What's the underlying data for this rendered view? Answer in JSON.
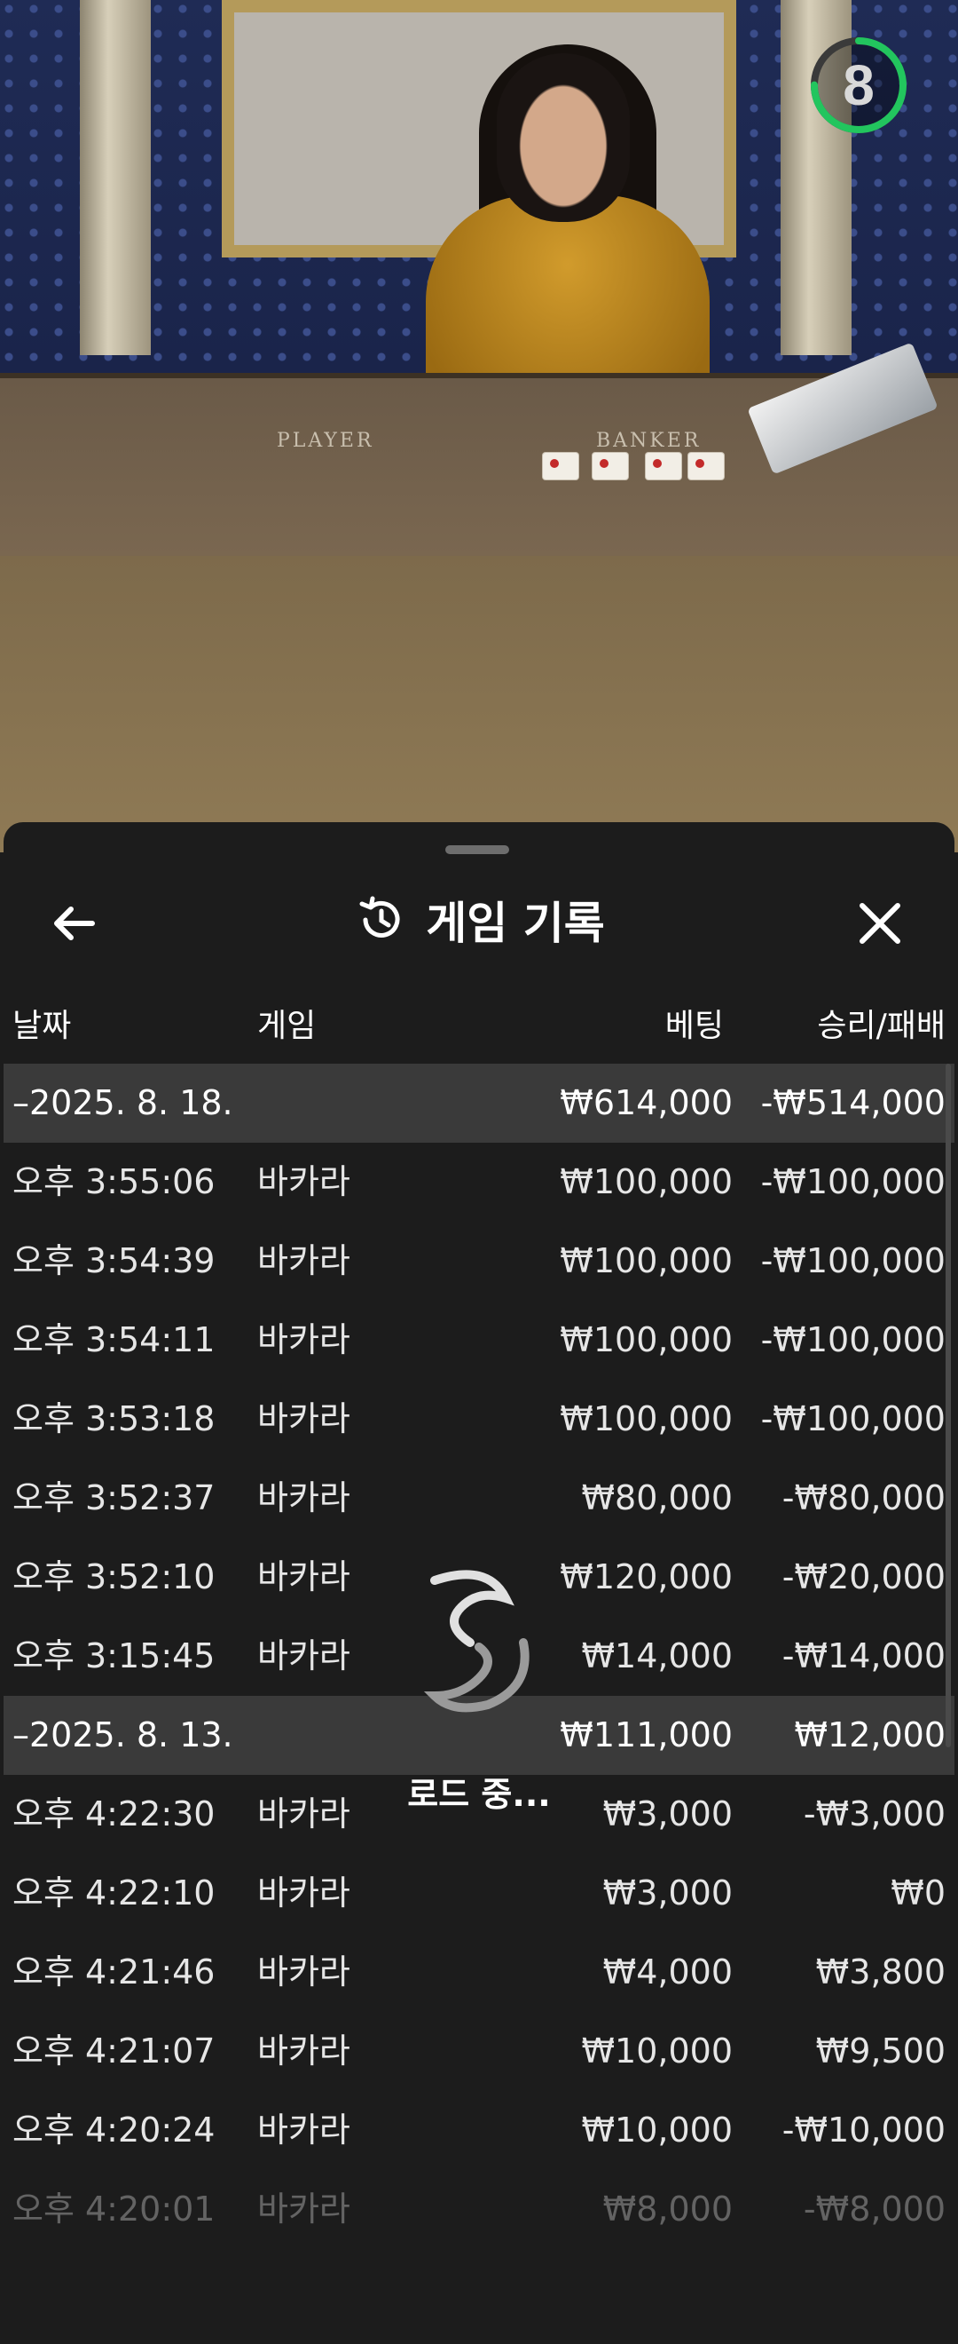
{
  "stream": {
    "countdown": "8",
    "countdown_progress": 0.75,
    "table_labels": [
      "PLAYER",
      "BANKER"
    ]
  },
  "sheet": {
    "title": "게임 기록",
    "back_icon": "back-arrow-icon",
    "history_icon": "history-clock-icon",
    "close_icon": "close-icon",
    "columns": {
      "date": "날짜",
      "game": "게임",
      "bet": "베팅",
      "result": "승리/패배"
    },
    "rows": [
      {
        "type": "day",
        "date": "–2025. 8. 18.",
        "game": "",
        "bet": "₩614,000",
        "result": "-₩514,000"
      },
      {
        "type": "game",
        "date": "오후 3:55:06",
        "game": "바카라",
        "bet": "₩100,000",
        "result": "-₩100,000"
      },
      {
        "type": "game",
        "date": "오후 3:54:39",
        "game": "바카라",
        "bet": "₩100,000",
        "result": "-₩100,000"
      },
      {
        "type": "game",
        "date": "오후 3:54:11",
        "game": "바카라",
        "bet": "₩100,000",
        "result": "-₩100,000"
      },
      {
        "type": "game",
        "date": "오후 3:53:18",
        "game": "바카라",
        "bet": "₩100,000",
        "result": "-₩100,000"
      },
      {
        "type": "game",
        "date": "오후 3:52:37",
        "game": "바카라",
        "bet": "₩80,000",
        "result": "-₩80,000"
      },
      {
        "type": "game",
        "date": "오후 3:52:10",
        "game": "바카라",
        "bet": "₩120,000",
        "result": "-₩20,000"
      },
      {
        "type": "game",
        "date": "오후 3:15:45",
        "game": "바카라",
        "bet": "₩14,000",
        "result": "-₩14,000"
      },
      {
        "type": "day",
        "date": "–2025. 8. 13.",
        "game": "",
        "bet": "₩111,000",
        "result": "₩12,000"
      },
      {
        "type": "game",
        "date": "오후 4:22:30",
        "game": "바카라",
        "bet": "₩3,000",
        "result": "-₩3,000"
      },
      {
        "type": "game",
        "date": "오후 4:22:10",
        "game": "바카라",
        "bet": "₩3,000",
        "result": "₩0"
      },
      {
        "type": "game",
        "date": "오후 4:21:46",
        "game": "바카라",
        "bet": "₩4,000",
        "result": "₩3,800"
      },
      {
        "type": "game",
        "date": "오후 4:21:07",
        "game": "바카라",
        "bet": "₩10,000",
        "result": "₩9,500"
      },
      {
        "type": "game",
        "date": "오후 4:20:24",
        "game": "바카라",
        "bet": "₩10,000",
        "result": "-₩10,000"
      },
      {
        "type": "game-faded",
        "date": "오후 4:20:01",
        "game": "바카라",
        "bet": "₩8,000",
        "result": "-₩8,000"
      }
    ],
    "loading_text": "로드 중...",
    "loading_icon": "loading-spinner-icon"
  },
  "colors": {
    "sheet_bg": "#1c1c1c",
    "day_row_bg": "#3a3a3a",
    "timer_green": "#22c55e",
    "text": "#ffffff"
  }
}
